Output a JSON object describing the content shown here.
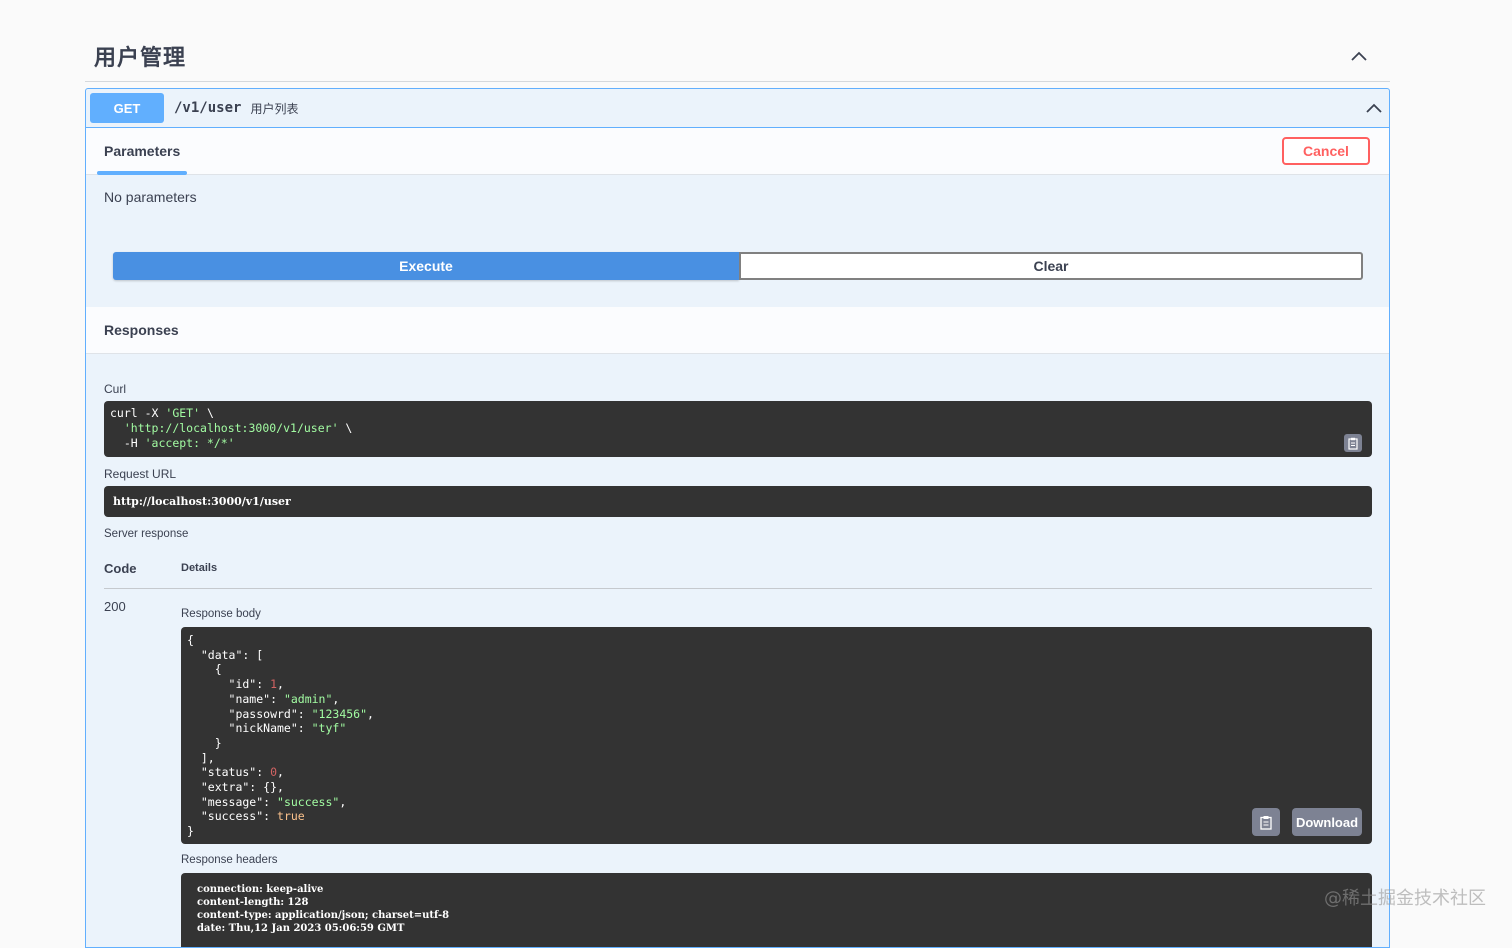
{
  "section": {
    "title": "用户管理"
  },
  "operation": {
    "method": "GET",
    "path": "/v1/user",
    "summary": "用户列表"
  },
  "parameters": {
    "tab_label": "Parameters",
    "cancel_label": "Cancel",
    "empty_text": "No parameters"
  },
  "actions": {
    "execute_label": "Execute",
    "clear_label": "Clear"
  },
  "responses": {
    "title": "Responses",
    "curl_label": "Curl",
    "curl_lines": [
      {
        "pre": "curl -X ",
        "str": "'GET'",
        "post": " \\"
      },
      {
        "pre": "  ",
        "str": "'http://localhost:3000/v1/user'",
        "post": " \\"
      },
      {
        "pre": "  -H ",
        "str": "'accept: */*'",
        "post": ""
      }
    ],
    "request_url_label": "Request URL",
    "request_url": "http://localhost:3000/v1/user",
    "server_response_label": "Server response",
    "code_header": "Code",
    "details_header": "Details",
    "status_code": "200",
    "response_body_label": "Response body",
    "download_label": "Download",
    "response_headers_label": "Response headers",
    "response_headers": [
      "connection: keep-alive",
      "content-length: 128",
      "content-type: application/json; charset=utf-8",
      "date: Thu,12 Jan 2023 05:06:59 GMT"
    ]
  },
  "watermark": "@稀土掘金技术社区",
  "colors": {
    "get_blue": "#61affe",
    "execute_blue": "#4990e2",
    "cancel_red": "#ff6060",
    "code_bg": "#333333",
    "string_green": "#a2fca2",
    "number_red": "#d36363",
    "bool_orange": "#fcc28c"
  },
  "icons": {
    "collapse": "chevron-up-icon",
    "copy": "clipboard-copy-icon"
  }
}
